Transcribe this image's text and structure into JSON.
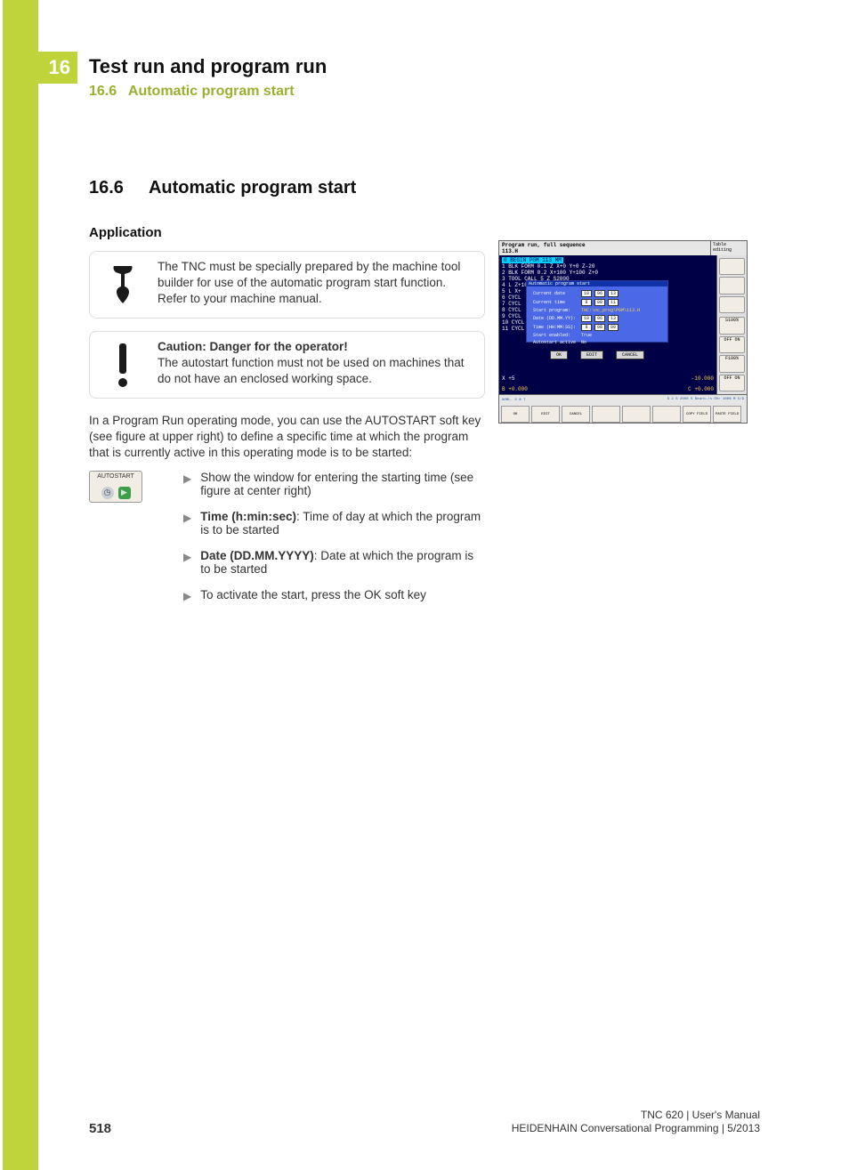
{
  "chapter_number": "16",
  "header": {
    "title": "Test run and program run",
    "subsection_number": "16.6",
    "subsection_title": "Automatic program start"
  },
  "section": {
    "number": "16.6",
    "title": "Automatic program start",
    "application_heading": "Application",
    "callout_machine": "The TNC must be specially prepared by the machine tool builder for use of the automatic program start function. Refer to your machine manual.",
    "callout_danger_title": "Caution: Danger for the operator!",
    "callout_danger_body": "The autostart function must not be used on machines that do not have an enclosed working space.",
    "paragraph": "In a Program Run operating mode, you can use the AUTOSTART soft key (see figure at upper right) to define a specific time at which the program that is currently active in this operating mode is to be started:",
    "softkey_label": "AUTOSTART",
    "steps": [
      {
        "bold": "",
        "text": "Show the window for entering the starting time (see figure at center right)"
      },
      {
        "bold": "Time (h:min:sec)",
        "text": ": Time of day at which the program is to be started"
      },
      {
        "bold": "Date (DD.MM.YYYY)",
        "text": ": Date at which the program is to be started"
      },
      {
        "bold": "",
        "text": "To activate the start, press the OK soft key"
      }
    ]
  },
  "tnc": {
    "mode_title": "Program run, full sequence",
    "side_title": "Table editing",
    "program_name": "113.H",
    "line0": "0  BEGIN PGM 113 MM",
    "code_lines": [
      "1  BLK FORM 0.1 Z X+0 Y+0 Z-20",
      "2  BLK FORM 0.2   X+100  Y+100   Z+0",
      "3  TOOL CALL 5 Z S2000",
      "4  L  Z+10 R0 FMAX M3",
      "5  L  X+",
      "6  CYCL",
      "7  CYCL",
      "8  CYCL",
      "9  CYCL",
      "10 CYCL",
      "11 CYCL"
    ],
    "popup": {
      "title": "Automatic program start",
      "current_date_label": "Current date",
      "current_date": [
        "18",
        "06",
        "13"
      ],
      "current_time_label": "Current time",
      "current_time": [
        "8",
        "08",
        "11"
      ],
      "start_program_label": "Start program:",
      "start_program_value": "TNC:\\nc_prog\\PGM\\113.H",
      "date_label": "Date (DD.MM.YY):",
      "date": [
        "18",
        "06",
        "13"
      ],
      "time_label": "Time (HH:MM:SS):",
      "time": [
        "8",
        "08",
        "00"
      ],
      "enabled_label": "Start enabled:",
      "enabled_value": "True",
      "active_label": "Autostart active",
      "active_value": "No",
      "btn_ok": "OK",
      "btn_edit": "EDIT",
      "btn_cancel": "CANCEL"
    },
    "dro": {
      "x_label": "X",
      "x_value": "+5",
      "z_value": "-10.000",
      "b_label": "B",
      "b_value": "+0.000",
      "c_label": "C",
      "c_value": "+0.000"
    },
    "status_bar": {
      "left": "NOML.  ⊙ ⊕  T",
      "right": "S 2 S  2000  S       Bearb./s    OVr  100%  M 5/9"
    },
    "side_panels": [
      "S100%",
      "OFF  ON",
      "F100%",
      "OFF  ON"
    ],
    "softkeys": [
      "OK",
      "EDIT",
      "CANCEL",
      "",
      "",
      "",
      "COPY FIELD",
      "PASTE FIELD"
    ]
  },
  "footer": {
    "page_number": "518",
    "product": "TNC 620 | User's Manual",
    "doc": "HEIDENHAIN Conversational Programming | 5/2013"
  }
}
